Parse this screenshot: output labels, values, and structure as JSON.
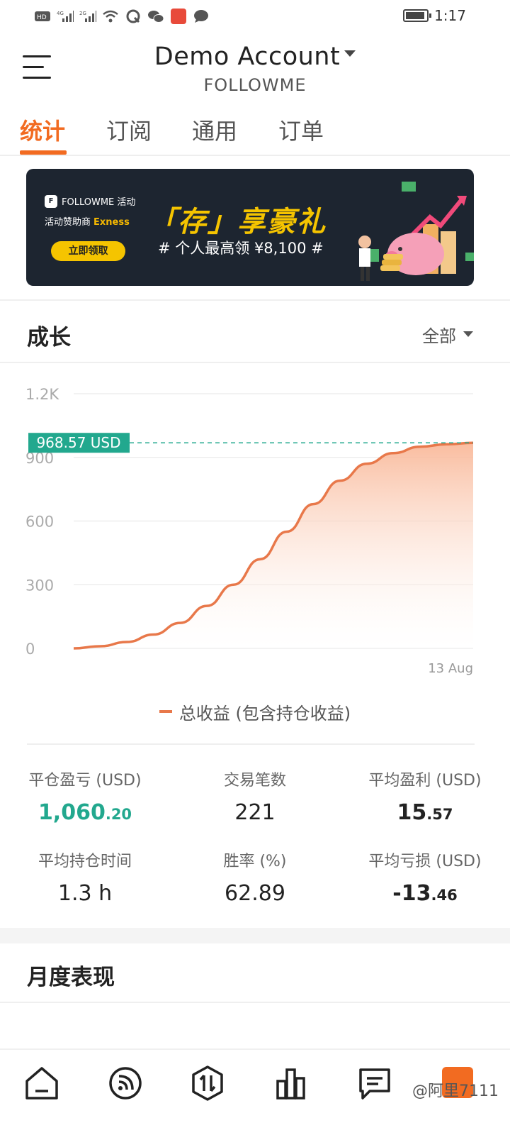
{
  "status_bar": {
    "time": "1:17",
    "icons": [
      "hd-icon",
      "signal-4g-icon",
      "signal-2g-icon",
      "wifi-icon",
      "q-app-icon",
      "wechat-icon",
      "app-red-icon",
      "message-icon",
      "battery-icon"
    ]
  },
  "header": {
    "title": "Demo Account",
    "subtitle": "FOLLOWME"
  },
  "tabs": [
    {
      "label": "统计",
      "active": true
    },
    {
      "label": "订阅",
      "active": false
    },
    {
      "label": "通用",
      "active": false
    },
    {
      "label": "订单",
      "active": false
    }
  ],
  "banner": {
    "brand": "FOLLOWME 活动",
    "sponsor_prefix": "活动赞助商",
    "sponsor_name": "Exness",
    "button": "立即领取",
    "headline": "「存」享豪礼",
    "sub": "# 个人最高领 ¥8,100 #"
  },
  "growth": {
    "title": "成长",
    "filter": "全部"
  },
  "chart_data": {
    "type": "area",
    "y_ticks": [
      "1.2K",
      "900",
      "600",
      "300",
      "0"
    ],
    "ylim": [
      0,
      1200
    ],
    "x_label_end": "13 Aug",
    "current_value_label": "968.57 USD",
    "current_value": 968.57,
    "series": [
      {
        "name": "总收益 (包含持仓收益)",
        "values": [
          0,
          10,
          30,
          65,
          120,
          200,
          300,
          420,
          550,
          680,
          790,
          870,
          920,
          950,
          962,
          968.57
        ]
      }
    ],
    "colors": {
      "line": "#e8784a",
      "fill_top": "#f9b99a",
      "marker_bg": "#22a88e"
    }
  },
  "stats": {
    "closed_pl_label": "平仓盈亏 (USD)",
    "closed_pl_int": "1,060",
    "closed_pl_dec": ".20",
    "trades_label": "交易笔数",
    "trades_value": "221",
    "avg_profit_label": "平均盈利 (USD)",
    "avg_profit_int": "15",
    "avg_profit_dec": ".57",
    "avg_hold_label": "平均持仓时间",
    "avg_hold_value": "1.3 h",
    "win_rate_label": "胜率 (%)",
    "win_rate_value": "62.89",
    "avg_loss_label": "平均亏损 (USD)",
    "avg_loss_int": "-13",
    "avg_loss_dec": ".46"
  },
  "monthly": {
    "title": "月度表现"
  },
  "bottom_nav": {
    "items": [
      "home-icon",
      "feed-icon",
      "trade-icon",
      "chart-bar-icon",
      "message-icon"
    ],
    "watermark": "@阿里7111"
  }
}
